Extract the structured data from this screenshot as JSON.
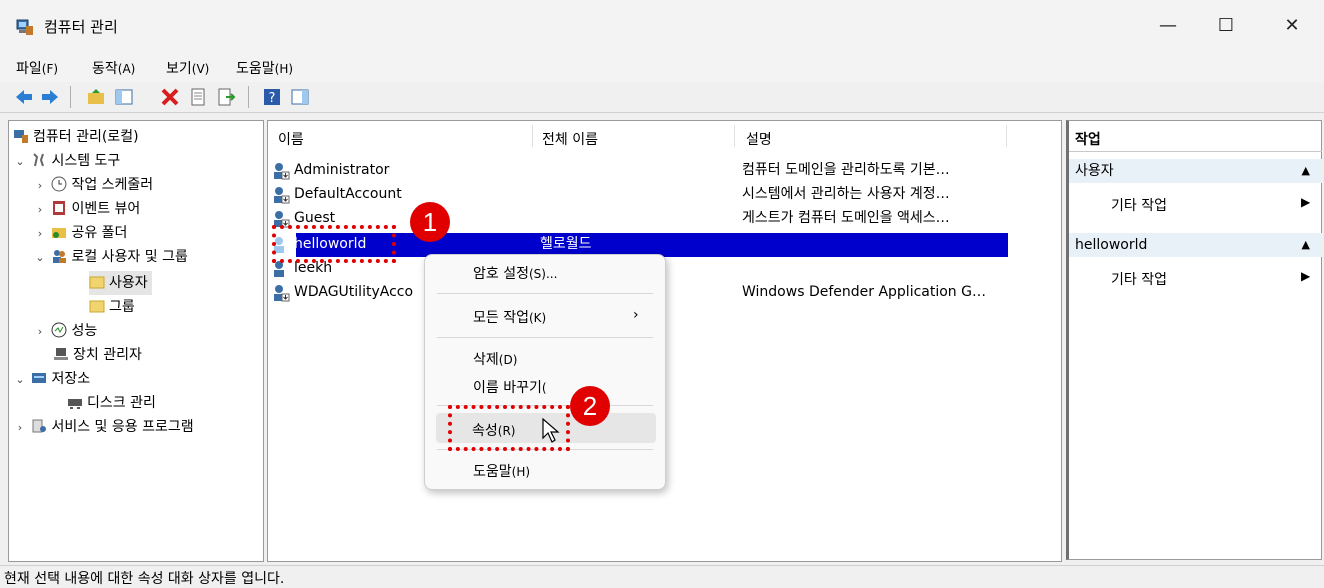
{
  "window": {
    "title": "컴퓨터 관리",
    "minimize": "—",
    "maximize": "☐",
    "close": "✕"
  },
  "menu": [
    {
      "label": "파일",
      "key": "(F)"
    },
    {
      "label": "동작",
      "key": "(A)"
    },
    {
      "label": "보기",
      "key": "(V)"
    },
    {
      "label": "도움말",
      "key": "(H)"
    }
  ],
  "tree": {
    "root": "컴퓨터 관리(로컬)",
    "system_tools": "시스템 도구",
    "task_scheduler": "작업 스케줄러",
    "event_viewer": "이벤트 뷰어",
    "shared_folders": "공유 폴더",
    "local_users_groups": "로컬 사용자 및 그룹",
    "users": "사용자",
    "groups": "그룹",
    "performance": "성능",
    "device_manager": "장치 관리자",
    "storage": "저장소",
    "disk_management": "디스크 관리",
    "services_apps": "서비스 및 응용 프로그램"
  },
  "list": {
    "columns": [
      "이름",
      "전체 이름",
      "설명"
    ],
    "rows": [
      {
        "name": "Administrator",
        "full": "",
        "desc": "컴퓨터 도메인을 관리하도록 기본…"
      },
      {
        "name": "DefaultAccount",
        "full": "",
        "desc": "시스템에서 관리하는 사용자 계정…"
      },
      {
        "name": "Guest",
        "full": "",
        "desc": "게스트가 컴퓨터 도메인을 액세스…"
      },
      {
        "name": "helloworld",
        "full": "헬로월드",
        "desc": ""
      },
      {
        "name": "leekh",
        "full": "",
        "desc": ""
      },
      {
        "name": "WDAGUtilityAcco",
        "full": "",
        "desc": "Windows Defender Application G…"
      }
    ]
  },
  "actions": {
    "header": "작업",
    "section1": "사용자",
    "section1_more": "기타 작업",
    "section2": "helloworld",
    "section2_more": "기타 작업"
  },
  "context_menu": {
    "set_password": "암호 설정",
    "set_password_key": "(S)...",
    "all_tasks": "모든 작업",
    "all_tasks_key": "(K)",
    "delete": "삭제",
    "delete_key": "(D)",
    "rename": "이름 바꾸기",
    "rename_key": "(",
    "properties": "속성",
    "properties_key": "(R)",
    "help": "도움말",
    "help_key": "(H)"
  },
  "annotations": {
    "badge1": "1",
    "badge2": "2"
  },
  "status": "현재 선택 내용에 대한 속성 대화 상자를 엽니다.",
  "colors": {
    "selection": "#0000cc",
    "annotation": "#e00000"
  }
}
